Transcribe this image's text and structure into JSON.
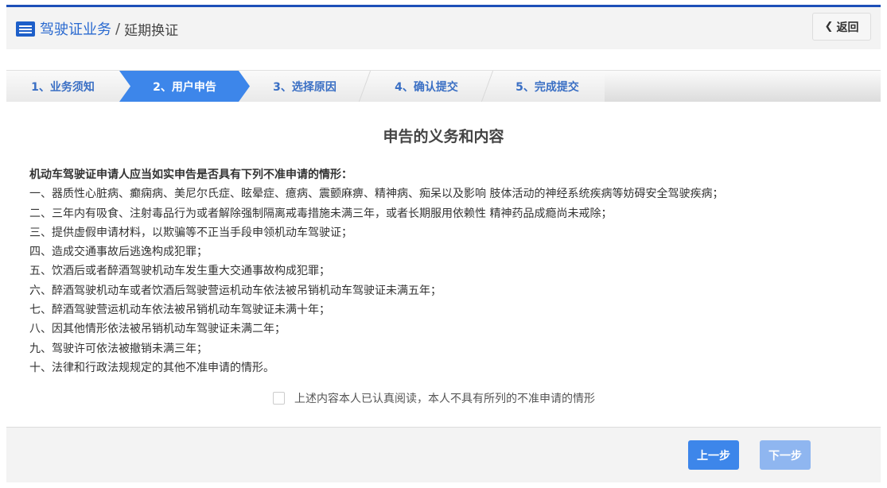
{
  "header": {
    "icon": "list-icon",
    "title_main": "驾驶证业务",
    "separator": "/",
    "title_sub": "延期换证",
    "back_label": "返回",
    "back_icon": "chevron-left-icon"
  },
  "steps": [
    {
      "label": "1、业务须知",
      "active": false
    },
    {
      "label": "2、用户申告",
      "active": true
    },
    {
      "label": "3、选择原因",
      "active": false
    },
    {
      "label": "4、确认提交",
      "active": false
    },
    {
      "label": "5、完成提交",
      "active": false
    }
  ],
  "colors": {
    "accent": "#3d86ea",
    "top_border": "#1d4fb8",
    "disabled_button": "#8fb6f0"
  },
  "main": {
    "heading": "申告的义务和内容",
    "lead": "机动车驾驶证申请人应当如实申告是否具有下列不准申请的情形：",
    "items": [
      "一、器质性心脏病、癫痫病、美尼尔氏症、眩晕症、癔病、震颤麻痹、精神病、痴呆以及影响 肢体活动的神经系统疾病等妨碍安全驾驶疾病；",
      "二、三年内有吸食、注射毒品行为或者解除强制隔离戒毒措施未满三年，或者长期服用依赖性 精神药品成瘾尚未戒除；",
      "三、提供虚假申请材料，以欺骗等不正当手段申领机动车驾驶证；",
      "四、造成交通事故后逃逸构成犯罪；",
      "五、饮酒后或者醉酒驾驶机动车发生重大交通事故构成犯罪；",
      "六、醉酒驾驶机动车或者饮酒后驾驶营运机动车依法被吊销机动车驾驶证未满五年；",
      "七、醉酒驾驶营运机动车依法被吊销机动车驾驶证未满十年；",
      "八、因其他情形依法被吊销机动车驾驶证未满二年；",
      "九、驾驶许可依法被撤销未满三年；",
      "十、法律和行政法规规定的其他不准申请的情形。"
    ],
    "agree_label": "上述内容本人已认真阅读，本人不具有所列的不准申请的情形",
    "agree_checked": false
  },
  "footer": {
    "prev_label": "上一步",
    "next_label": "下一步",
    "next_enabled": false
  }
}
